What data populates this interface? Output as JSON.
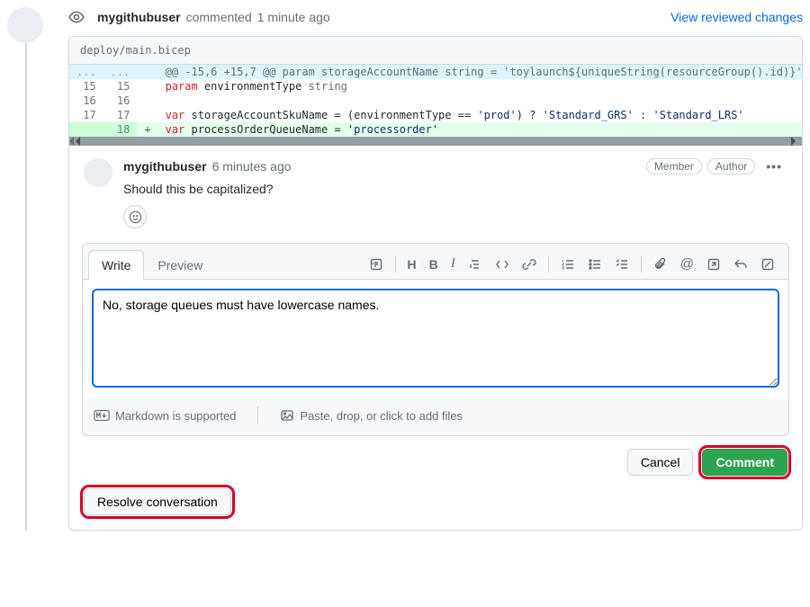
{
  "header": {
    "username": "mygithubuser",
    "action": "commented",
    "time": "1 minute ago",
    "review_link": "View reviewed changes"
  },
  "file": {
    "path": "deploy/main.bicep"
  },
  "diff": {
    "hunk": "@@ -15,6 +15,7 @@ param storageAccountName string = 'toylaunch${uniqueString(resourceGroup().id)}'",
    "rows": [
      {
        "old": "15",
        "new": "15",
        "plus": "",
        "code_html": "<span class='kw-red'>param</span> environmentType <span class='op-gray'>string</span>"
      },
      {
        "old": "16",
        "new": "16",
        "plus": "",
        "code_html": ""
      },
      {
        "old": "17",
        "new": "17",
        "plus": "",
        "code_html": "<span class='kw-red'>var</span> storageAccountSkuName = (environmentType == <span class='str-blue'>'prod'</span>) ? <span class='str-blue'>'Standard_GRS'</span> : <span class='str-blue'>'Standard_LRS'</span>"
      },
      {
        "old": "",
        "new": "18",
        "plus": "+",
        "add": true,
        "code_html": "<span class='kw-red'>var</span> processOrderQueueName = <span class='str-blue'>'processorder'</span>"
      }
    ]
  },
  "comment": {
    "username": "mygithubuser",
    "time": "6 minutes ago",
    "badges": [
      "Member",
      "Author"
    ],
    "body": "Should this be capitalized?"
  },
  "editor": {
    "tabs": {
      "write": "Write",
      "preview": "Preview"
    },
    "text": "No, storage queues must have lowercase names.",
    "footer": {
      "markdown": "Markdown is supported",
      "attach": "Paste, drop, or click to add files"
    }
  },
  "buttons": {
    "cancel": "Cancel",
    "comment": "Comment",
    "resolve": "Resolve conversation"
  }
}
